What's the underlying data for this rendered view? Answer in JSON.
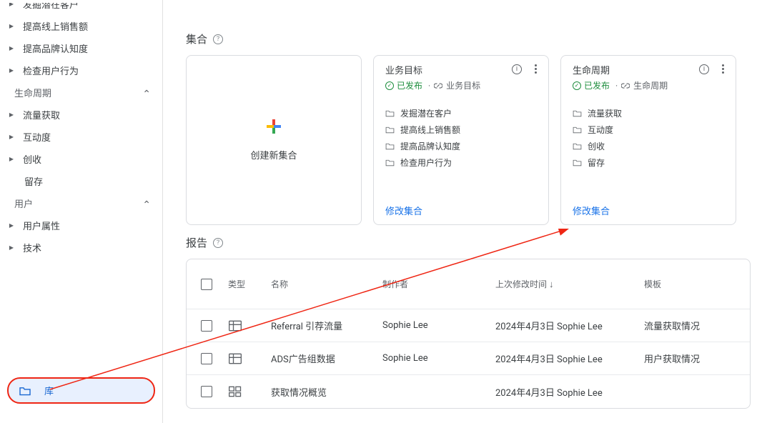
{
  "sidebar": {
    "top_items": [
      {
        "label": "发掘潜在客户",
        "partial": true
      },
      {
        "label": "提高线上销售额"
      },
      {
        "label": "提高品牌认知度"
      },
      {
        "label": "检查用户行为"
      }
    ],
    "group_lifecycle": {
      "header": "生命周期",
      "items": [
        {
          "label": "流量获取",
          "caret": true
        },
        {
          "label": "互动度",
          "caret": true
        },
        {
          "label": "创收",
          "caret": true
        },
        {
          "label": "留存",
          "caret": false
        }
      ]
    },
    "group_user": {
      "header": "用户",
      "items": [
        {
          "label": "用户属性",
          "caret": true
        },
        {
          "label": "技术",
          "caret": true
        }
      ]
    },
    "library_label": "库"
  },
  "main": {
    "collections_title": "集合",
    "create_card_label": "创建新集合",
    "card_biz": {
      "title": "业务目标",
      "status": "已发布",
      "meta_label": "业务目标",
      "items": [
        "发掘潜在客户",
        "提高线上销售额",
        "提高品牌认知度",
        "检查用户行为"
      ],
      "edit_label": "修改集合"
    },
    "card_life": {
      "title": "生命周期",
      "status": "已发布",
      "meta_label": "生命周期",
      "items": [
        "流量获取",
        "互动度",
        "创收",
        "留存"
      ],
      "edit_label": "修改集合"
    },
    "reports_title": "报告",
    "table": {
      "headers": {
        "type": "类型",
        "name": "名称",
        "author": "制作者",
        "date": "上次修改时间",
        "template": "模板"
      },
      "rows": [
        {
          "type": "table",
          "name": "Referral 引荐流量",
          "author": "Sophie Lee",
          "date": "2024年4月3日 Sophie Lee",
          "template": "流量获取情况"
        },
        {
          "type": "table",
          "name": "ADS广告组数据",
          "author": "Sophie Lee",
          "date": "2024年4月3日 Sophie Lee",
          "template": "用户获取情况"
        },
        {
          "type": "dash",
          "name": "获取情况概览",
          "author": "",
          "date": "2024年4月3日 Sophie Lee",
          "template": ""
        }
      ]
    }
  }
}
